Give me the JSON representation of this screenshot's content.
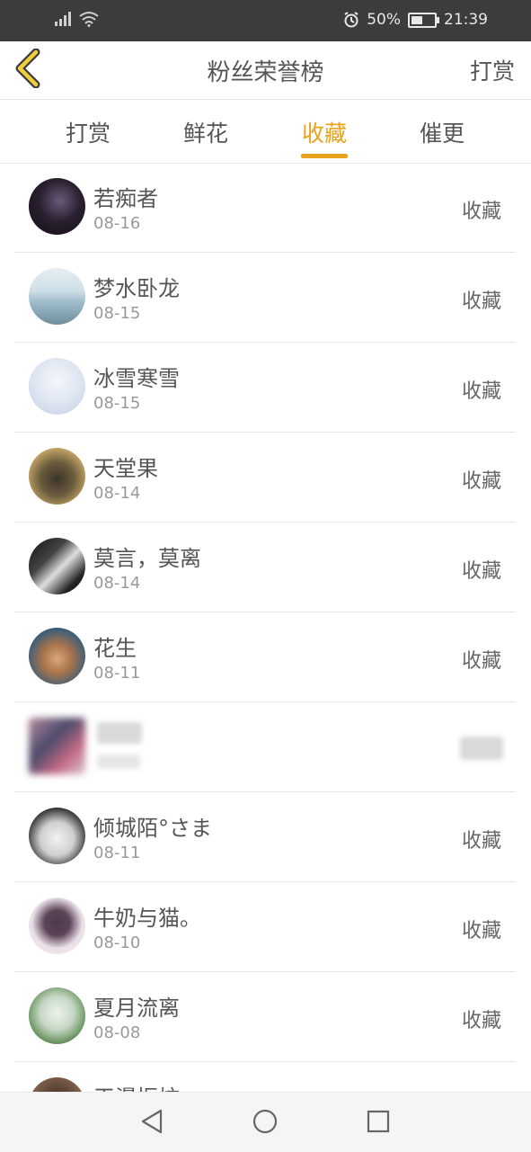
{
  "status_bar": {
    "battery_percent": "50%",
    "time": "21:39",
    "icons": [
      "signal-icon",
      "wifi-icon",
      "alarm-icon",
      "battery-icon"
    ]
  },
  "header": {
    "title": "粉丝荣誉榜",
    "right_action": "打赏",
    "back_icon": "chevron-left-icon"
  },
  "tabs": [
    {
      "label": "打赏",
      "active": false
    },
    {
      "label": "鲜花",
      "active": false
    },
    {
      "label": "收藏",
      "active": true
    },
    {
      "label": "催更",
      "active": false
    }
  ],
  "accent_color": "#e8a21c",
  "fans": [
    {
      "name": "若痴者",
      "date": "08-16",
      "action": "收藏"
    },
    {
      "name": "梦水卧龙",
      "date": "08-15",
      "action": "收藏"
    },
    {
      "name": "冰雪寒雪",
      "date": "08-15",
      "action": "收藏"
    },
    {
      "name": "天堂果",
      "date": "08-14",
      "action": "收藏"
    },
    {
      "name": "莫言，莫离",
      "date": "08-14",
      "action": "收藏"
    },
    {
      "name": "花生",
      "date": "08-11",
      "action": "收藏"
    },
    {
      "name": "",
      "date": "",
      "action": "",
      "blurred": true
    },
    {
      "name": "倾城陌°さま",
      "date": "08-11",
      "action": "收藏"
    },
    {
      "name": "牛奶与猫。",
      "date": "08-10",
      "action": "收藏"
    },
    {
      "name": "夏月流离",
      "date": "08-08",
      "action": "收藏"
    },
    {
      "name": "天漫振炫",
      "date": "",
      "action": ""
    }
  ],
  "nav_bar": {
    "icons": [
      "back-triangle-icon",
      "home-circle-icon",
      "recents-square-icon"
    ]
  }
}
